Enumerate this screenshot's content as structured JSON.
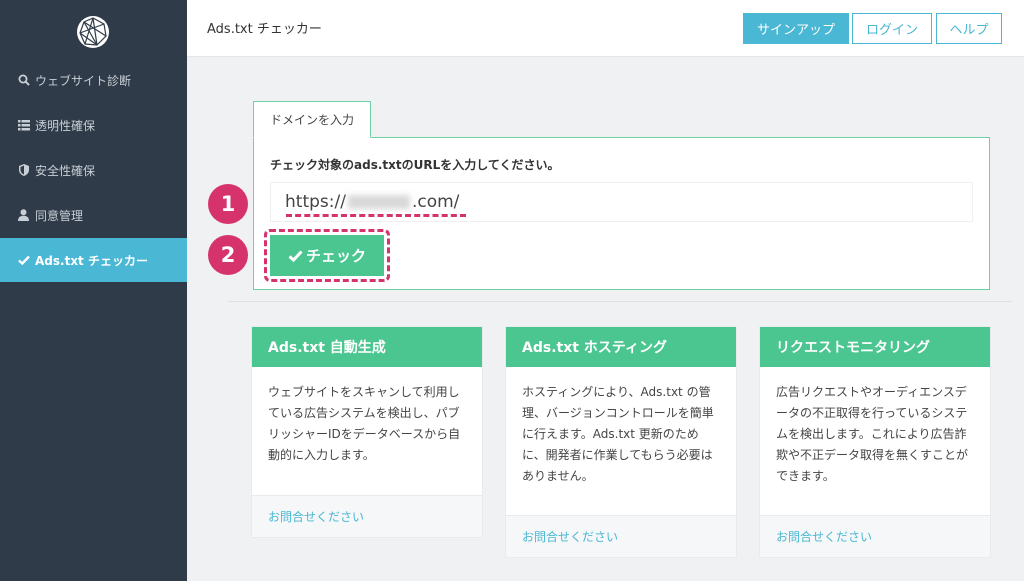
{
  "header": {
    "title": "Ads.txt チェッカー",
    "signup_label": "サインアップ",
    "login_label": "ログイン",
    "help_label": "ヘルプ"
  },
  "sidebar": {
    "items": [
      {
        "label": "ウェブサイト診断",
        "icon": "search-icon"
      },
      {
        "label": "透明性確保",
        "icon": "list-icon"
      },
      {
        "label": "安全性確保",
        "icon": "shield-icon"
      },
      {
        "label": "同意管理",
        "icon": "user-icon"
      },
      {
        "label": "Ads.txt チェッカー",
        "icon": "check-icon",
        "active": true
      }
    ]
  },
  "domain_form": {
    "tab_label": "ドメインを入力",
    "label": "チェック対象のads.txtのURLを入力してください。",
    "url_prefix": "https://",
    "url_suffix": ".com/",
    "check_button_label": "チェック"
  },
  "annotations": {
    "badge1": "1",
    "badge2": "2"
  },
  "cards": [
    {
      "title": "Ads.txt 自動生成",
      "body": "ウェブサイトをスキャンして利用している広告システムを検出し、パブリッシャーIDをデータベースから自動的に入力します。",
      "link": "お問合せください"
    },
    {
      "title": "Ads.txt ホスティング",
      "body": "ホスティングにより、Ads.txt の管理、バージョンコントロールを簡単に行えます。Ads.txt 更新のために、開発者に作業してもらう必要はありません。",
      "link": "お問合せください"
    },
    {
      "title": "リクエストモニタリング",
      "body": "広告リクエストやオーディエンスデータの不正取得を行っているシステムを検出します。これにより広告詐欺や不正データ取得を無くすことができます。",
      "link": "お問合せください"
    }
  ],
  "colors": {
    "sidebar_bg": "#2f3b48",
    "accent_blue": "#4ab7d4",
    "accent_green": "#4cc690",
    "annotation_pink": "#d6336c"
  }
}
